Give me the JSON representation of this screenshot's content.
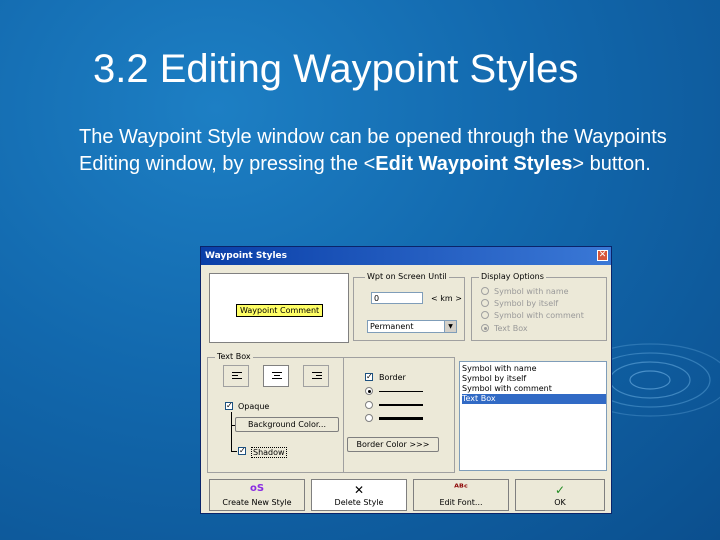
{
  "slide": {
    "title": "3.2 Editing Waypoint Styles",
    "body_prefix": "The Waypoint Style window can be opened through the Waypoints Editing window, by pressing the <",
    "body_bold": "Edit Waypoint Styles",
    "body_suffix": "> button."
  },
  "dialog": {
    "title": "Waypoint Styles",
    "preview_label": "Waypoint Comment",
    "wpt_group_label": "Wpt on Screen Until",
    "wpt_value": "0",
    "wpt_unit": "< km >",
    "duration_value": "Permanent",
    "display_group_label": "Display Options",
    "display_options": [
      "Symbol with name",
      "Symbol by itself",
      "Symbol with comment",
      "Text Box"
    ],
    "textbox_group_label": "Text Box",
    "opaque_label": "Opaque",
    "background_color_button": "Background Color...",
    "shadow_label": "Shadow",
    "border_label": "Border",
    "border_color_button": "Border Color >>>",
    "style_list": [
      "Symbol with name",
      "Symbol by itself",
      "Symbol with comment",
      "Text Box"
    ],
    "selected_style": "Text Box",
    "buttons": {
      "create": "Create New Style",
      "delete": "Delete Style",
      "edit_font": "Edit Font...",
      "ok": "OK"
    }
  },
  "colors": {
    "background": "#1268ad",
    "titlebar": "#0a3fa8",
    "selection": "#316ac5",
    "preview_highlight": "#ffff66"
  }
}
